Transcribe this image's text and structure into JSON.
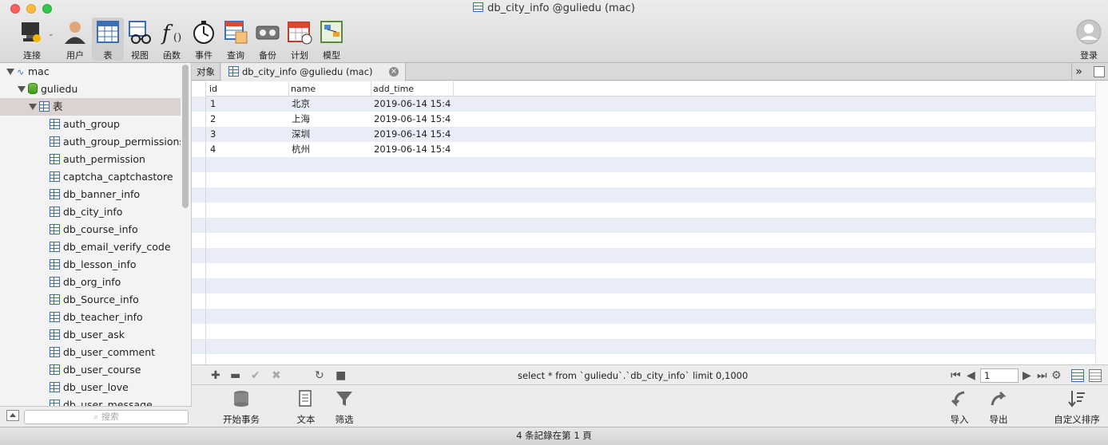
{
  "window": {
    "title": "db_city_info @guliedu (mac)"
  },
  "toolbar": {
    "items": [
      {
        "label": "连接",
        "icon": "connection-icon"
      },
      {
        "label": "用户",
        "icon": "user-icon"
      },
      {
        "label": "表",
        "icon": "table-icon"
      },
      {
        "label": "视图",
        "icon": "view-icon"
      },
      {
        "label": "函数",
        "icon": "function-icon"
      },
      {
        "label": "事件",
        "icon": "event-icon"
      },
      {
        "label": "查询",
        "icon": "query-icon"
      },
      {
        "label": "备份",
        "icon": "backup-icon"
      },
      {
        "label": "计划",
        "icon": "schedule-icon"
      },
      {
        "label": "模型",
        "icon": "model-icon"
      }
    ],
    "login_label": "登录"
  },
  "sidebar": {
    "connection": "mac",
    "database": "guliedu",
    "group": "表",
    "tables": [
      "auth_group",
      "auth_group_permissions",
      "auth_permission",
      "captcha_captchastore",
      "db_banner_info",
      "db_city_info",
      "db_course_info",
      "db_email_verify_code",
      "db_lesson_info",
      "db_org_info",
      "db_Source_info",
      "db_teacher_info",
      "db_user_ask",
      "db_user_comment",
      "db_user_course",
      "db_user_love",
      "db_user_message"
    ],
    "search_placeholder": "搜索"
  },
  "tabs": {
    "objects_label": "对象",
    "active_label": "db_city_info @guliedu (mac)"
  },
  "grid": {
    "columns": [
      "id",
      "name",
      "add_time"
    ],
    "rows": [
      [
        "1",
        "北京",
        "2019-06-14 15:4"
      ],
      [
        "2",
        "上海",
        "2019-06-14 15:4"
      ],
      [
        "3",
        "深圳",
        "2019-06-14 15:4"
      ],
      [
        "4",
        "杭州",
        "2019-06-14 15:4"
      ]
    ]
  },
  "gridbar": {
    "sql": "select * from `guliedu`.`db_city_info`  limit 0,1000",
    "page": "1"
  },
  "actions": {
    "begin_transaction": "开始事务",
    "text": "文本",
    "filter": "筛选",
    "import": "导入",
    "export": "导出",
    "custom_sort": "自定义排序"
  },
  "status": {
    "text": "4 条記錄在第 1 頁"
  },
  "colors": {
    "accent": "#3a6fb5",
    "row_stripe": "#e9edf8",
    "selection": "#dcd2d2"
  }
}
